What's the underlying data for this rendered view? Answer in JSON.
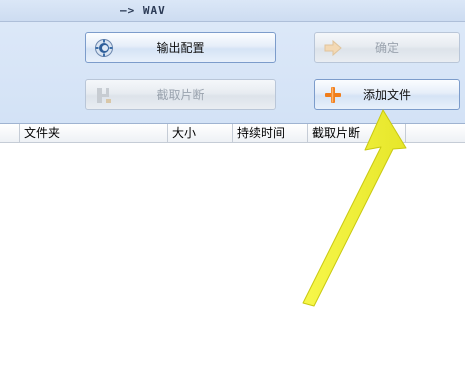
{
  "window": {
    "title": "–> WAV"
  },
  "toolbar": {
    "output_config": {
      "label": "输出配置",
      "icon": "gear-icon",
      "enabled": true
    },
    "confirm": {
      "label": "确定",
      "icon": "arrow-right-icon",
      "enabled": false
    },
    "cut_segment": {
      "label": "截取片断",
      "icon": "film-cut-icon",
      "enabled": false
    },
    "add_file": {
      "label": "添加文件",
      "icon": "plus-icon",
      "enabled": true
    }
  },
  "file_list": {
    "columns": [
      "文件夹",
      "大小",
      "持续时间",
      "截取片断"
    ],
    "rows": []
  },
  "colors": {
    "toolbar_bg": "#d8e5f7",
    "button_border": "#7c9ccb",
    "pointer_arrow": "#f2f23a",
    "plus_icon": "#f07d1a"
  }
}
